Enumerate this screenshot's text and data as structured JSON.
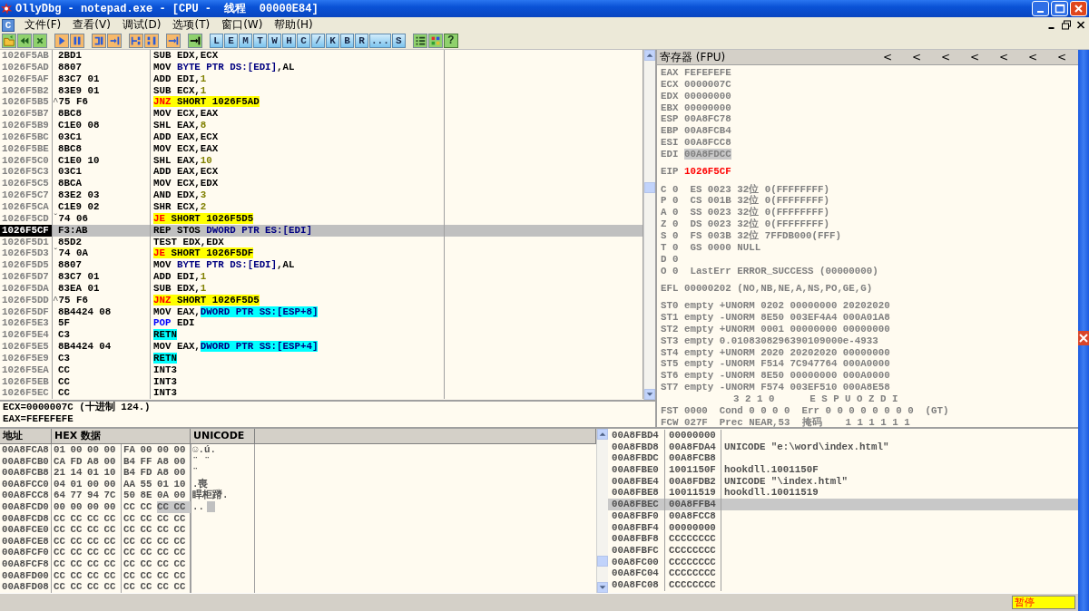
{
  "window": {
    "title": "OllyDbg - notepad.exe - [CPU -  线程  00000E84]"
  },
  "menu": {
    "system_icon": "C",
    "items": [
      "文件(F)",
      "查看(V)",
      "调试(D)",
      "选项(T)",
      "窗口(W)",
      "帮助(H)"
    ]
  },
  "toolbar": {
    "groups": [
      [
        {
          "kind": "icon"
        },
        {
          "kind": "icon"
        },
        {
          "kind": "icon"
        }
      ],
      [
        {
          "kind": "icon"
        },
        {
          "kind": "icon"
        }
      ],
      [
        {
          "kind": "icon"
        },
        {
          "kind": "icon"
        }
      ],
      [
        {
          "kind": "icon"
        },
        {
          "kind": "icon"
        }
      ],
      [
        {
          "kind": "icon"
        }
      ],
      [
        {
          "kind": "icon"
        }
      ],
      [
        {
          "kind": "letter",
          "label": "L"
        },
        {
          "kind": "letter",
          "label": "E"
        },
        {
          "kind": "letter",
          "label": "M"
        },
        {
          "kind": "letter",
          "label": "T"
        },
        {
          "kind": "letter",
          "label": "W"
        },
        {
          "kind": "letter",
          "label": "H"
        },
        {
          "kind": "letter",
          "label": "C"
        },
        {
          "kind": "letter",
          "label": "/"
        },
        {
          "kind": "letter",
          "label": "K"
        },
        {
          "kind": "letter",
          "label": "B"
        },
        {
          "kind": "letter",
          "label": "R"
        },
        {
          "kind": "letter",
          "label": "..."
        },
        {
          "kind": "letter",
          "label": "S"
        }
      ],
      [
        {
          "kind": "icon"
        },
        {
          "kind": "icon"
        },
        {
          "kind": "help",
          "label": "?"
        }
      ]
    ]
  },
  "disasm": {
    "rows": [
      {
        "address": "1026F5AB",
        "hex": "2BD1",
        "selected": false,
        "instruction": [
          {
            "text": "SUB EDX,ECX",
            "kind": "plain"
          }
        ]
      },
      {
        "address": "1026F5AD",
        "hex": "8807",
        "selected": false,
        "instruction": [
          {
            "text": "MOV ",
            "kind": "plain"
          },
          {
            "text": "BYTE PTR DS:[EDI]",
            "kind": "mem"
          },
          {
            "text": ",AL",
            "kind": "plain"
          }
        ]
      },
      {
        "address": "1026F5AF",
        "hex": "83C7 01",
        "selected": false,
        "instruction": [
          {
            "text": "ADD EDI,",
            "kind": "plain"
          },
          {
            "text": "1",
            "kind": "imm"
          }
        ]
      },
      {
        "address": "1026F5B2",
        "hex": "83E9 01",
        "selected": false,
        "instruction": [
          {
            "text": "SUB ECX,",
            "kind": "plain"
          },
          {
            "text": "1",
            "kind": "imm"
          }
        ]
      },
      {
        "address": "1026F5B5",
        "jump_mark": "^",
        "hex": "75 F6",
        "selected": false,
        "instruction": [
          {
            "text": "JNZ",
            "kind": "jmp"
          },
          {
            "text": " SHORT 1026F5AD",
            "kind": "target"
          }
        ]
      },
      {
        "address": "1026F5B7",
        "hex": "8BC8",
        "selected": false,
        "instruction": [
          {
            "text": "MOV ECX,EAX",
            "kind": "plain"
          }
        ]
      },
      {
        "address": "1026F5B9",
        "hex": "C1E0 08",
        "selected": false,
        "instruction": [
          {
            "text": "SHL EAX,",
            "kind": "plain"
          },
          {
            "text": "8",
            "kind": "imm"
          }
        ]
      },
      {
        "address": "1026F5BC",
        "hex": "03C1",
        "selected": false,
        "instruction": [
          {
            "text": "ADD EAX,ECX",
            "kind": "plain"
          }
        ]
      },
      {
        "address": "1026F5BE",
        "hex": "8BC8",
        "selected": false,
        "instruction": [
          {
            "text": "MOV ECX,EAX",
            "kind": "plain"
          }
        ]
      },
      {
        "address": "1026F5C0",
        "hex": "C1E0 10",
        "selected": false,
        "instruction": [
          {
            "text": "SHL EAX,",
            "kind": "plain"
          },
          {
            "text": "10",
            "kind": "imm"
          }
        ]
      },
      {
        "address": "1026F5C3",
        "hex": "03C1",
        "selected": false,
        "instruction": [
          {
            "text": "ADD EAX,ECX",
            "kind": "plain"
          }
        ]
      },
      {
        "address": "1026F5C5",
        "hex": "8BCA",
        "selected": false,
        "instruction": [
          {
            "text": "MOV ECX,EDX",
            "kind": "plain"
          }
        ]
      },
      {
        "address": "1026F5C7",
        "hex": "83E2 03",
        "selected": false,
        "instruction": [
          {
            "text": "AND EDX,",
            "kind": "plain"
          },
          {
            "text": "3",
            "kind": "imm"
          }
        ]
      },
      {
        "address": "1026F5CA",
        "hex": "C1E9 02",
        "selected": false,
        "instruction": [
          {
            "text": "SHR ECX,",
            "kind": "plain"
          },
          {
            "text": "2",
            "kind": "imm"
          }
        ]
      },
      {
        "address": "1026F5CD",
        "jump_mark": "ˇ",
        "hex": "74 06",
        "selected": false,
        "instruction": [
          {
            "text": "JE",
            "kind": "jmp"
          },
          {
            "text": " SHORT 1026F5D5",
            "kind": "target"
          }
        ]
      },
      {
        "address": "1026F5CF",
        "hex": "F3:AB",
        "selected": true,
        "instruction": [
          {
            "text": "REP STOS ",
            "kind": "plain"
          },
          {
            "text": "DWORD PTR ES:[EDI]",
            "kind": "mem"
          }
        ]
      },
      {
        "address": "1026F5D1",
        "hex": "85D2",
        "selected": false,
        "instruction": [
          {
            "text": "TEST EDX,EDX",
            "kind": "plain"
          }
        ]
      },
      {
        "address": "1026F5D3",
        "jump_mark": "ˇ",
        "hex": "74 0A",
        "selected": false,
        "instruction": [
          {
            "text": "JE",
            "kind": "jmp"
          },
          {
            "text": " SHORT 1026F5DF",
            "kind": "target"
          }
        ]
      },
      {
        "address": "1026F5D5",
        "hex": "8807",
        "selected": false,
        "instruction": [
          {
            "text": "MOV ",
            "kind": "plain"
          },
          {
            "text": "BYTE PTR DS:[EDI]",
            "kind": "mem"
          },
          {
            "text": ",AL",
            "kind": "plain"
          }
        ]
      },
      {
        "address": "1026F5D7",
        "hex": "83C7 01",
        "selected": false,
        "instruction": [
          {
            "text": "ADD EDI,",
            "kind": "plain"
          },
          {
            "text": "1",
            "kind": "imm"
          }
        ]
      },
      {
        "address": "1026F5DA",
        "hex": "83EA 01",
        "selected": false,
        "instruction": [
          {
            "text": "SUB EDX,",
            "kind": "plain"
          },
          {
            "text": "1",
            "kind": "imm"
          }
        ]
      },
      {
        "address": "1026F5DD",
        "jump_mark": "^",
        "hex": "75 F6",
        "selected": false,
        "instruction": [
          {
            "text": "JNZ",
            "kind": "jmp"
          },
          {
            "text": " SHORT 1026F5D5",
            "kind": "target"
          }
        ]
      },
      {
        "address": "1026F5DF",
        "hex": "8B4424 08",
        "selected": false,
        "instruction": [
          {
            "text": "MOV EAX,",
            "kind": "plain"
          },
          {
            "text": "DWORD PTR SS:[ESP+8]",
            "kind": "memhl"
          }
        ]
      },
      {
        "address": "1026F5E3",
        "hex": "5F",
        "selected": false,
        "instruction": [
          {
            "text": "POP",
            "kind": "pop"
          },
          {
            "text": " EDI",
            "kind": "plain"
          }
        ]
      },
      {
        "address": "1026F5E4",
        "hex": "C3",
        "selected": false,
        "instruction": [
          {
            "text": "RETN",
            "kind": "ret"
          }
        ]
      },
      {
        "address": "1026F5E5",
        "hex": "8B4424 04",
        "selected": false,
        "instruction": [
          {
            "text": "MOV EAX,",
            "kind": "plain"
          },
          {
            "text": "DWORD PTR SS:[ESP+4]",
            "kind": "memhl"
          }
        ]
      },
      {
        "address": "1026F5E9",
        "hex": "C3",
        "selected": false,
        "instruction": [
          {
            "text": "RETN",
            "kind": "ret"
          }
        ]
      },
      {
        "address": "1026F5EA",
        "hex": "CC",
        "selected": false,
        "instruction": [
          {
            "text": "INT3",
            "kind": "plain"
          }
        ]
      },
      {
        "address": "1026F5EB",
        "hex": "CC",
        "selected": false,
        "instruction": [
          {
            "text": "INT3",
            "kind": "plain"
          }
        ]
      },
      {
        "address": "1026F5EC",
        "hex": "CC",
        "selected": false,
        "instruction": [
          {
            "text": "INT3",
            "kind": "plain"
          }
        ]
      }
    ]
  },
  "info": {
    "lines": [
      "ECX=0000007C (十进制 124.)",
      "EAX=FEFEFEFE"
    ]
  },
  "registers": {
    "title": "寄存器 (FPU)",
    "arrows": [
      "<",
      "<",
      "<",
      "<",
      "<",
      "<",
      "<"
    ],
    "groups": [
      {
        "kind": "regs",
        "items": [
          {
            "name": "EAX",
            "value": "FEFEFEFE",
            "changed": false,
            "selected": false
          },
          {
            "name": "ECX",
            "value": "0000007C",
            "changed": false,
            "selected": false
          },
          {
            "name": "EDX",
            "value": "00000000",
            "changed": false,
            "selected": false
          },
          {
            "name": "EBX",
            "value": "00000000",
            "changed": false,
            "selected": false
          },
          {
            "name": "ESP",
            "value": "00A8FC78",
            "changed": false,
            "selected": false
          },
          {
            "name": "EBP",
            "value": "00A8FCB4",
            "changed": false,
            "selected": false
          },
          {
            "name": "ESI",
            "value": "00A8FCC8",
            "changed": false,
            "selected": false
          },
          {
            "name": "EDI",
            "value": "00A8FDCC",
            "changed": false,
            "selected": true
          }
        ]
      },
      {
        "kind": "regs",
        "items": [
          {
            "name": "EIP",
            "value": "1026F5CF",
            "changed": true,
            "selected": false
          }
        ]
      },
      {
        "kind": "lines",
        "lines": [
          {
            "text": "C 0  ES 0023 32位 0(FFFFFFFF)",
            "kind": "line"
          },
          {
            "text": "P 0  CS 001B 32位 0(FFFFFFFF)",
            "kind": "line"
          },
          {
            "text": "A 0  SS 0023 32位 0(FFFFFFFF)",
            "kind": "line"
          },
          {
            "text": "Z 0  DS 0023 32位 0(FFFFFFFF)",
            "kind": "line"
          },
          {
            "text": "S 0  FS 003B 32位 7FFDB000(FFF)",
            "kind": "line"
          },
          {
            "text": "T 0  GS 0000 NULL",
            "kind": "line"
          },
          {
            "text": "D 0",
            "kind": "line"
          },
          {
            "text": "O 0  LastErr ERROR_SUCCESS (00000000)",
            "kind": "line"
          }
        ]
      },
      {
        "kind": "lines",
        "lines": [
          {
            "text": "EFL 00000202 (NO,NB,NE,A,NS,PO,GE,G)",
            "kind": "line"
          }
        ]
      },
      {
        "kind": "lines",
        "lines": [
          {
            "text": "ST0 empty +UNORM 0202 00000000 20202020",
            "kind": "line"
          },
          {
            "text": "ST1 empty -UNORM 8E50 003EF4A4 000A01A8",
            "kind": "line"
          },
          {
            "text": "ST2 empty +UNORM 0001 00000000 00000000",
            "kind": "line"
          },
          {
            "text": "ST3 empty 0.0108308296390109000e-4933",
            "kind": "line"
          },
          {
            "text": "ST4 empty +UNORM 2020 20202020 00000000",
            "kind": "line"
          },
          {
            "text": "ST5 empty -UNORM F514 7C947764 000A0000",
            "kind": "line"
          },
          {
            "text": "ST6 empty -UNORM 8E50 00000000 000A0000",
            "kind": "line"
          },
          {
            "text": "ST7 empty -UNORM F574 003EF510 000A8E58",
            "kind": "line"
          },
          {
            "text": "3 2 1 0      E S P U O Z D I",
            "kind": "header"
          },
          {
            "text": "FST 0000  Cond 0 0 0 0  Err 0 0 0 0 0 0 0 0  (GT)",
            "kind": "line"
          },
          {
            "text": "FCW 027F  Prec NEAR,53  掩码    1 1 1 1 1 1",
            "kind": "line"
          }
        ]
      }
    ]
  },
  "dump": {
    "columns": [
      "地址",
      "HEX 数据",
      "UNICODE"
    ],
    "rows": [
      {
        "address": "00A8FCA8",
        "unicode": "☺.ú.",
        "unicode_selected": false,
        "bytes": [
          {
            "text": "01",
            "selected": false
          },
          {
            "text": "00",
            "selected": false
          },
          {
            "text": "00",
            "selected": false
          },
          {
            "text": "00",
            "selected": false
          },
          {
            "text": "FA",
            "selected": false
          },
          {
            "text": "00",
            "selected": false
          },
          {
            "text": "00",
            "selected": false
          },
          {
            "text": "00",
            "selected": false
          }
        ]
      },
      {
        "address": "00A8FCB0",
        "unicode": "¨ ¨",
        "unicode_selected": false,
        "bytes": [
          {
            "text": "CA",
            "selected": false
          },
          {
            "text": "FD",
            "selected": false
          },
          {
            "text": "A8",
            "selected": false
          },
          {
            "text": "00",
            "selected": false
          },
          {
            "text": "B4",
            "selected": false
          },
          {
            "text": "FF",
            "selected": false
          },
          {
            "text": "A8",
            "selected": false
          },
          {
            "text": "00",
            "selected": false
          }
        ]
      },
      {
        "address": "00A8FCB8",
        "unicode": "¨",
        "unicode_selected": false,
        "bytes": [
          {
            "text": "21",
            "selected": false
          },
          {
            "text": "14",
            "selected": false
          },
          {
            "text": "01",
            "selected": false
          },
          {
            "text": "10",
            "selected": false
          },
          {
            "text": "B4",
            "selected": false
          },
          {
            "text": "FD",
            "selected": false
          },
          {
            "text": "A8",
            "selected": false
          },
          {
            "text": "00",
            "selected": false
          }
        ]
      },
      {
        "address": "00A8FCC0",
        "unicode": ".喪",
        "unicode_selected": false,
        "bytes": [
          {
            "text": "04",
            "selected": false
          },
          {
            "text": "01",
            "selected": false
          },
          {
            "text": "00",
            "selected": false
          },
          {
            "text": "00",
            "selected": false
          },
          {
            "text": "AA",
            "selected": false
          },
          {
            "text": "55",
            "selected": false
          },
          {
            "text": "01",
            "selected": false
          },
          {
            "text": "10",
            "selected": false
          }
        ]
      },
      {
        "address": "00A8FCC8",
        "unicode": "睅柜蹐.",
        "unicode_selected": false,
        "bytes": [
          {
            "text": "64",
            "selected": false
          },
          {
            "text": "77",
            "selected": false
          },
          {
            "text": "94",
            "selected": false
          },
          {
            "text": "7C",
            "selected": false
          },
          {
            "text": "50",
            "selected": false
          },
          {
            "text": "8E",
            "selected": false
          },
          {
            "text": "0A",
            "selected": false
          },
          {
            "text": "00",
            "selected": false
          }
        ]
      },
      {
        "address": "00A8FCD0",
        "unicode": "..",
        "unicode_selected": true,
        "bytes": [
          {
            "text": "00",
            "selected": false
          },
          {
            "text": "00",
            "selected": false
          },
          {
            "text": "00",
            "selected": false
          },
          {
            "text": "00",
            "selected": false
          },
          {
            "text": "CC",
            "selected": false
          },
          {
            "text": "CC",
            "selected": false
          },
          {
            "text": "CC",
            "selected": true
          },
          {
            "text": "CC",
            "selected": true
          }
        ]
      },
      {
        "address": "00A8FCD8",
        "unicode_selected": false,
        "bytes": [
          {
            "text": "CC",
            "selected": false
          },
          {
            "text": "CC",
            "selected": false
          },
          {
            "text": "CC",
            "selected": false
          },
          {
            "text": "CC",
            "selected": false
          },
          {
            "text": "CC",
            "selected": false
          },
          {
            "text": "CC",
            "selected": false
          },
          {
            "text": "CC",
            "selected": false
          },
          {
            "text": "CC",
            "selected": false
          }
        ]
      },
      {
        "address": "00A8FCE0",
        "unicode_selected": false,
        "bytes": [
          {
            "text": "CC",
            "selected": false
          },
          {
            "text": "CC",
            "selected": false
          },
          {
            "text": "CC",
            "selected": false
          },
          {
            "text": "CC",
            "selected": false
          },
          {
            "text": "CC",
            "selected": false
          },
          {
            "text": "CC",
            "selected": false
          },
          {
            "text": "CC",
            "selected": false
          },
          {
            "text": "CC",
            "selected": false
          }
        ]
      },
      {
        "address": "00A8FCE8",
        "unicode_selected": false,
        "bytes": [
          {
            "text": "CC",
            "selected": false
          },
          {
            "text": "CC",
            "selected": false
          },
          {
            "text": "CC",
            "selected": false
          },
          {
            "text": "CC",
            "selected": false
          },
          {
            "text": "CC",
            "selected": false
          },
          {
            "text": "CC",
            "selected": false
          },
          {
            "text": "CC",
            "selected": false
          },
          {
            "text": "CC",
            "selected": false
          }
        ]
      },
      {
        "address": "00A8FCF0",
        "unicode_selected": false,
        "bytes": [
          {
            "text": "CC",
            "selected": false
          },
          {
            "text": "CC",
            "selected": false
          },
          {
            "text": "CC",
            "selected": false
          },
          {
            "text": "CC",
            "selected": false
          },
          {
            "text": "CC",
            "selected": false
          },
          {
            "text": "CC",
            "selected": false
          },
          {
            "text": "CC",
            "selected": false
          },
          {
            "text": "CC",
            "selected": false
          }
        ]
      },
      {
        "address": "00A8FCF8",
        "unicode_selected": false,
        "bytes": [
          {
            "text": "CC",
            "selected": false
          },
          {
            "text": "CC",
            "selected": false
          },
          {
            "text": "CC",
            "selected": false
          },
          {
            "text": "CC",
            "selected": false
          },
          {
            "text": "CC",
            "selected": false
          },
          {
            "text": "CC",
            "selected": false
          },
          {
            "text": "CC",
            "selected": false
          },
          {
            "text": "CC",
            "selected": false
          }
        ]
      },
      {
        "address": "00A8FD00",
        "unicode_selected": false,
        "bytes": [
          {
            "text": "CC",
            "selected": false
          },
          {
            "text": "CC",
            "selected": false
          },
          {
            "text": "CC",
            "selected": false
          },
          {
            "text": "CC",
            "selected": false
          },
          {
            "text": "CC",
            "selected": false
          },
          {
            "text": "CC",
            "selected": false
          },
          {
            "text": "CC",
            "selected": false
          },
          {
            "text": "CC",
            "selected": false
          }
        ]
      },
      {
        "address": "00A8FD08",
        "unicode_selected": false,
        "bytes": [
          {
            "text": "CC",
            "selected": false
          },
          {
            "text": "CC",
            "selected": false
          },
          {
            "text": "CC",
            "selected": false
          },
          {
            "text": "CC",
            "selected": false
          },
          {
            "text": "CC",
            "selected": false
          },
          {
            "text": "CC",
            "selected": false
          },
          {
            "text": "CC",
            "selected": false
          },
          {
            "text": "CC",
            "selected": false
          }
        ]
      }
    ]
  },
  "stack": {
    "rows": [
      {
        "address": "00A8FBD4",
        "value": "00000000",
        "selected": false
      },
      {
        "address": "00A8FBD8",
        "value": "00A8FDA4",
        "comment": "UNICODE \"e:\\word\\index.html\"",
        "selected": false
      },
      {
        "address": "00A8FBDC",
        "value": "00A8FCB8",
        "selected": false
      },
      {
        "address": "00A8FBE0",
        "value": "1001150F",
        "comment": "hookdll.1001150F",
        "selected": false
      },
      {
        "address": "00A8FBE4",
        "value": "00A8FDB2",
        "comment": "UNICODE \"\\index.html\"",
        "selected": false
      },
      {
        "address": "00A8FBE8",
        "value": "10011519",
        "comment": "hookdll.10011519",
        "selected": false
      },
      {
        "address": "00A8FBEC",
        "value": "00A8FFB4",
        "selected": true
      },
      {
        "address": "00A8FBF0",
        "value": "00A8FCC8",
        "selected": false
      },
      {
        "address": "00A8FBF4",
        "value": "00000000",
        "selected": false
      },
      {
        "address": "00A8FBF8",
        "value": "CCCCCCCC",
        "selected": false
      },
      {
        "address": "00A8FBFC",
        "value": "CCCCCCCC",
        "selected": false
      },
      {
        "address": "00A8FC00",
        "value": "CCCCCCCC",
        "selected": false
      },
      {
        "address": "00A8FC04",
        "value": "CCCCCCCC",
        "selected": false
      },
      {
        "address": "00A8FC08",
        "value": "CCCCCCCC",
        "selected": false
      }
    ]
  },
  "status_bar": {
    "state": "暂停"
  }
}
